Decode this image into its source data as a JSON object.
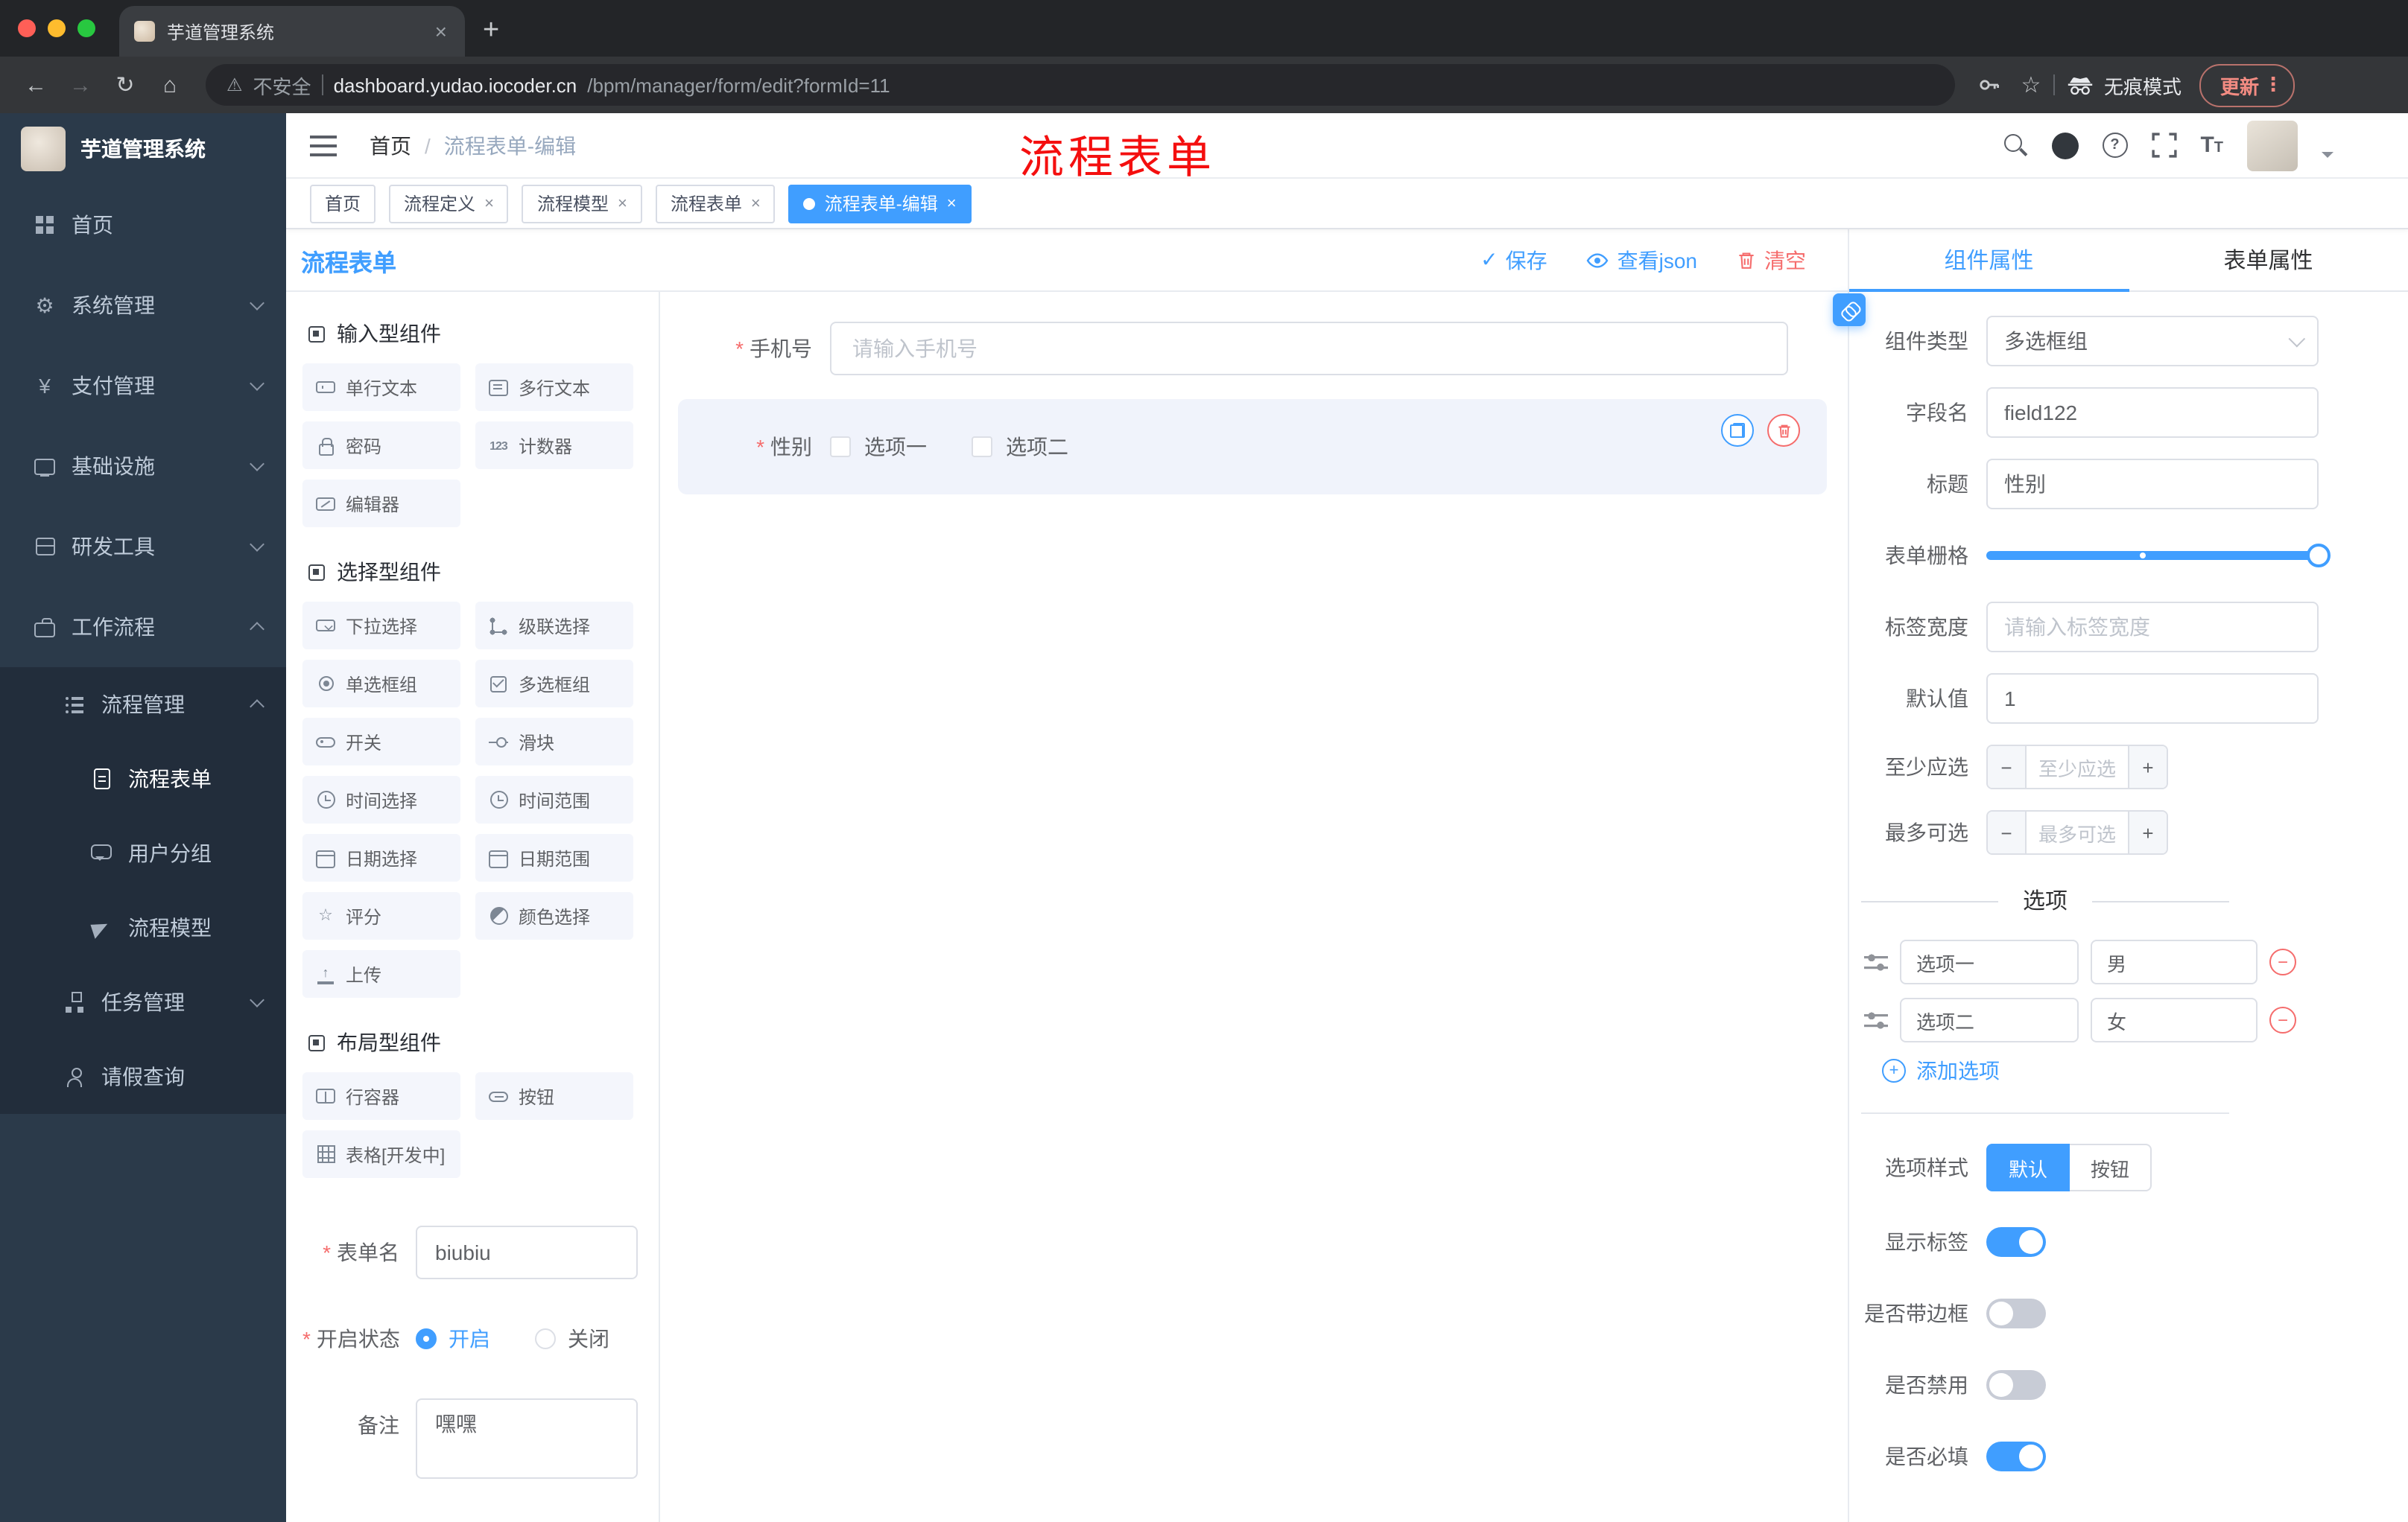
{
  "palette": {
    "accent": "#409eff",
    "danger": "#f56c6c",
    "annotation_red": "#f40f0f",
    "sidebar_bg": "#2b3a4a",
    "sidebar_submenu_bg": "#222d3b"
  },
  "icons": {
    "back": "←",
    "forward": "→",
    "reload": "↻",
    "home": "⌂",
    "warning": "⚠",
    "star": "☆",
    "kebab": "⋮",
    "close": "×",
    "new_tab": "+",
    "gear": "⚙",
    "yen": "¥",
    "check": "✓",
    "question": "?",
    "counter": "123",
    "rate": "☆",
    "upload": "↑",
    "font_size": "T",
    "minus": "−",
    "plus": "+"
  },
  "browser": {
    "tab_title": "芋道管理系统",
    "security_label": "不安全",
    "url_domain": "dashboard.yudao.iocoder.cn",
    "url_path": "/bpm/manager/form/edit?formId=11",
    "incognito_label": "无痕模式",
    "update_label": "更新"
  },
  "sidebar": {
    "logo_title": "芋道管理系统",
    "items": [
      {
        "label": "首页"
      },
      {
        "label": "系统管理"
      },
      {
        "label": "支付管理"
      },
      {
        "label": "基础设施"
      },
      {
        "label": "研发工具"
      },
      {
        "label": "工作流程"
      },
      {
        "label": "流程管理"
      },
      {
        "label": "流程表单"
      },
      {
        "label": "用户分组"
      },
      {
        "label": "流程模型"
      },
      {
        "label": "任务管理"
      },
      {
        "label": "请假查询"
      }
    ]
  },
  "header": {
    "breadcrumb_home": "首页",
    "breadcrumb_sep": "/",
    "breadcrumb_current": "流程表单-编辑",
    "annotation": "流程表单"
  },
  "tags": [
    {
      "label": "首页"
    },
    {
      "label": "流程定义"
    },
    {
      "label": "流程模型"
    },
    {
      "label": "流程表单"
    },
    {
      "label": "流程表单-编辑"
    }
  ],
  "designer": {
    "title": "流程表单",
    "save_label": "保存",
    "view_json_label": "查看json",
    "clear_label": "清空",
    "groups": [
      {
        "title": "输入型组件",
        "items": [
          "单行文本",
          "多行文本",
          "密码",
          "计数器",
          "编辑器"
        ]
      },
      {
        "title": "选择型组件",
        "items": [
          "下拉选择",
          "级联选择",
          "单选框组",
          "多选框组",
          "开关",
          "滑块",
          "时间选择",
          "时间范围",
          "日期选择",
          "日期范围",
          "评分",
          "颜色选择",
          "上传"
        ]
      },
      {
        "title": "布局型组件",
        "items": [
          "行容器",
          "按钮",
          "表格[开发中]"
        ]
      }
    ],
    "meta": {
      "form_name_label": "表单名",
      "form_name_value": "biubiu",
      "status_label": "开启状态",
      "status_on": "开启",
      "status_off": "关闭",
      "remark_label": "备注",
      "remark_value": "嘿嘿"
    },
    "canvas": {
      "phone_label": "手机号",
      "phone_placeholder": "请输入手机号",
      "gender_label": "性别",
      "gender_option1": "选项一",
      "gender_option2": "选项二"
    }
  },
  "props": {
    "tab_component": "组件属性",
    "tab_form": "表单属性",
    "component_type_label": "组件类型",
    "component_type_value": "多选框组",
    "field_name_label": "字段名",
    "field_name_value": "field122",
    "title_label": "标题",
    "title_value": "性别",
    "grid_label": "表单栅格",
    "label_width_label": "标签宽度",
    "label_width_placeholder": "请输入标签宽度",
    "default_label": "默认值",
    "default_value": "1",
    "min_label": "至少应选",
    "min_placeholder": "至少应选",
    "max_label": "最多可选",
    "max_placeholder": "最多可选",
    "options_title": "选项",
    "options": [
      {
        "label": "选项一",
        "value": "男"
      },
      {
        "label": "选项二",
        "value": "女"
      }
    ],
    "add_option_label": "添加选项",
    "style_label": "选项样式",
    "style_default": "默认",
    "style_button": "按钮",
    "toggle_show_label": "显示标签",
    "toggle_border_label": "是否带边框",
    "toggle_disabled_label": "是否禁用",
    "toggle_required_label": "是否必填"
  }
}
